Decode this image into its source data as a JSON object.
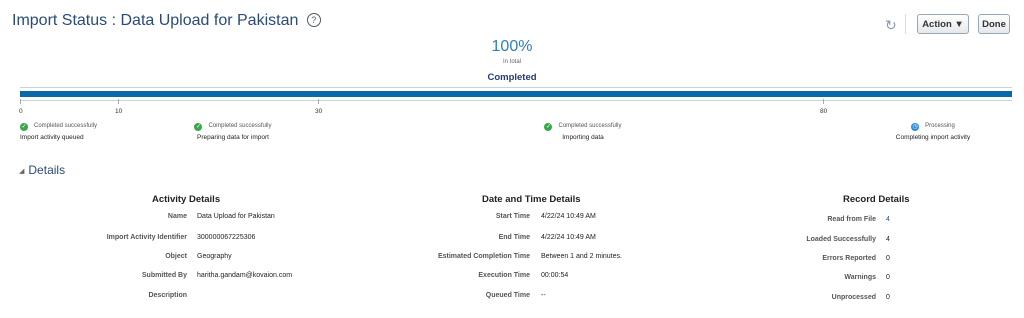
{
  "header": {
    "title": "Import Status : Data Upload for Pakistan",
    "help_glyph": "?",
    "refresh_icon": "refresh-icon",
    "action_label": "Action ▼",
    "done_label": "Done"
  },
  "progress": {
    "percent_text": "100%",
    "percent_value": 100,
    "in_total": "In total",
    "status": "Completed",
    "ticks": [
      "0",
      "10",
      "30",
      "80"
    ],
    "steps": [
      {
        "status": "Completed successfully",
        "name": "Import activity queued",
        "state": "done"
      },
      {
        "status": "Completed successfully",
        "name": "Preparing data for import",
        "state": "done"
      },
      {
        "status": "Completed successfully",
        "name": "Importing data",
        "state": "done"
      },
      {
        "status": "Processing",
        "name": "Completing import activity",
        "state": "processing"
      }
    ]
  },
  "details": {
    "heading": "Details",
    "activity": {
      "title": "Activity Details",
      "rows": [
        {
          "label": "Name",
          "value": "Data Upload for Pakistan"
        },
        {
          "label": "Import Activity Identifier",
          "value": "300000067225306"
        },
        {
          "label": "Object",
          "value": "Geography"
        },
        {
          "label": "Submitted By",
          "value": "haritha.gandam@kovaion.com"
        },
        {
          "label": "Description",
          "value": ""
        }
      ]
    },
    "datetime": {
      "title": "Date and Time Details",
      "rows": [
        {
          "label": "Start Time",
          "value": "4/22/24 10:49 AM"
        },
        {
          "label": "End Time",
          "value": "4/22/24 10:49 AM"
        },
        {
          "label": "Estimated Completion Time",
          "value": "Between 1 and 2 minutes."
        },
        {
          "label": "Execution Time",
          "value": "00:00:54"
        },
        {
          "label": "Queued Time",
          "value": "--"
        }
      ]
    },
    "records": {
      "title": "Record Details",
      "rows": [
        {
          "label": "Read from File",
          "value": "4"
        },
        {
          "label": "Loaded Successfully",
          "value": "4"
        },
        {
          "label": "Errors Reported",
          "value": "0"
        },
        {
          "label": "Warnings",
          "value": "0"
        },
        {
          "label": "Unprocessed",
          "value": "0"
        }
      ]
    }
  },
  "colors": {
    "bar": "#0a6aa8",
    "title": "#2a4a7a",
    "success": "#3aa84a",
    "processing": "#2e8ad6"
  }
}
